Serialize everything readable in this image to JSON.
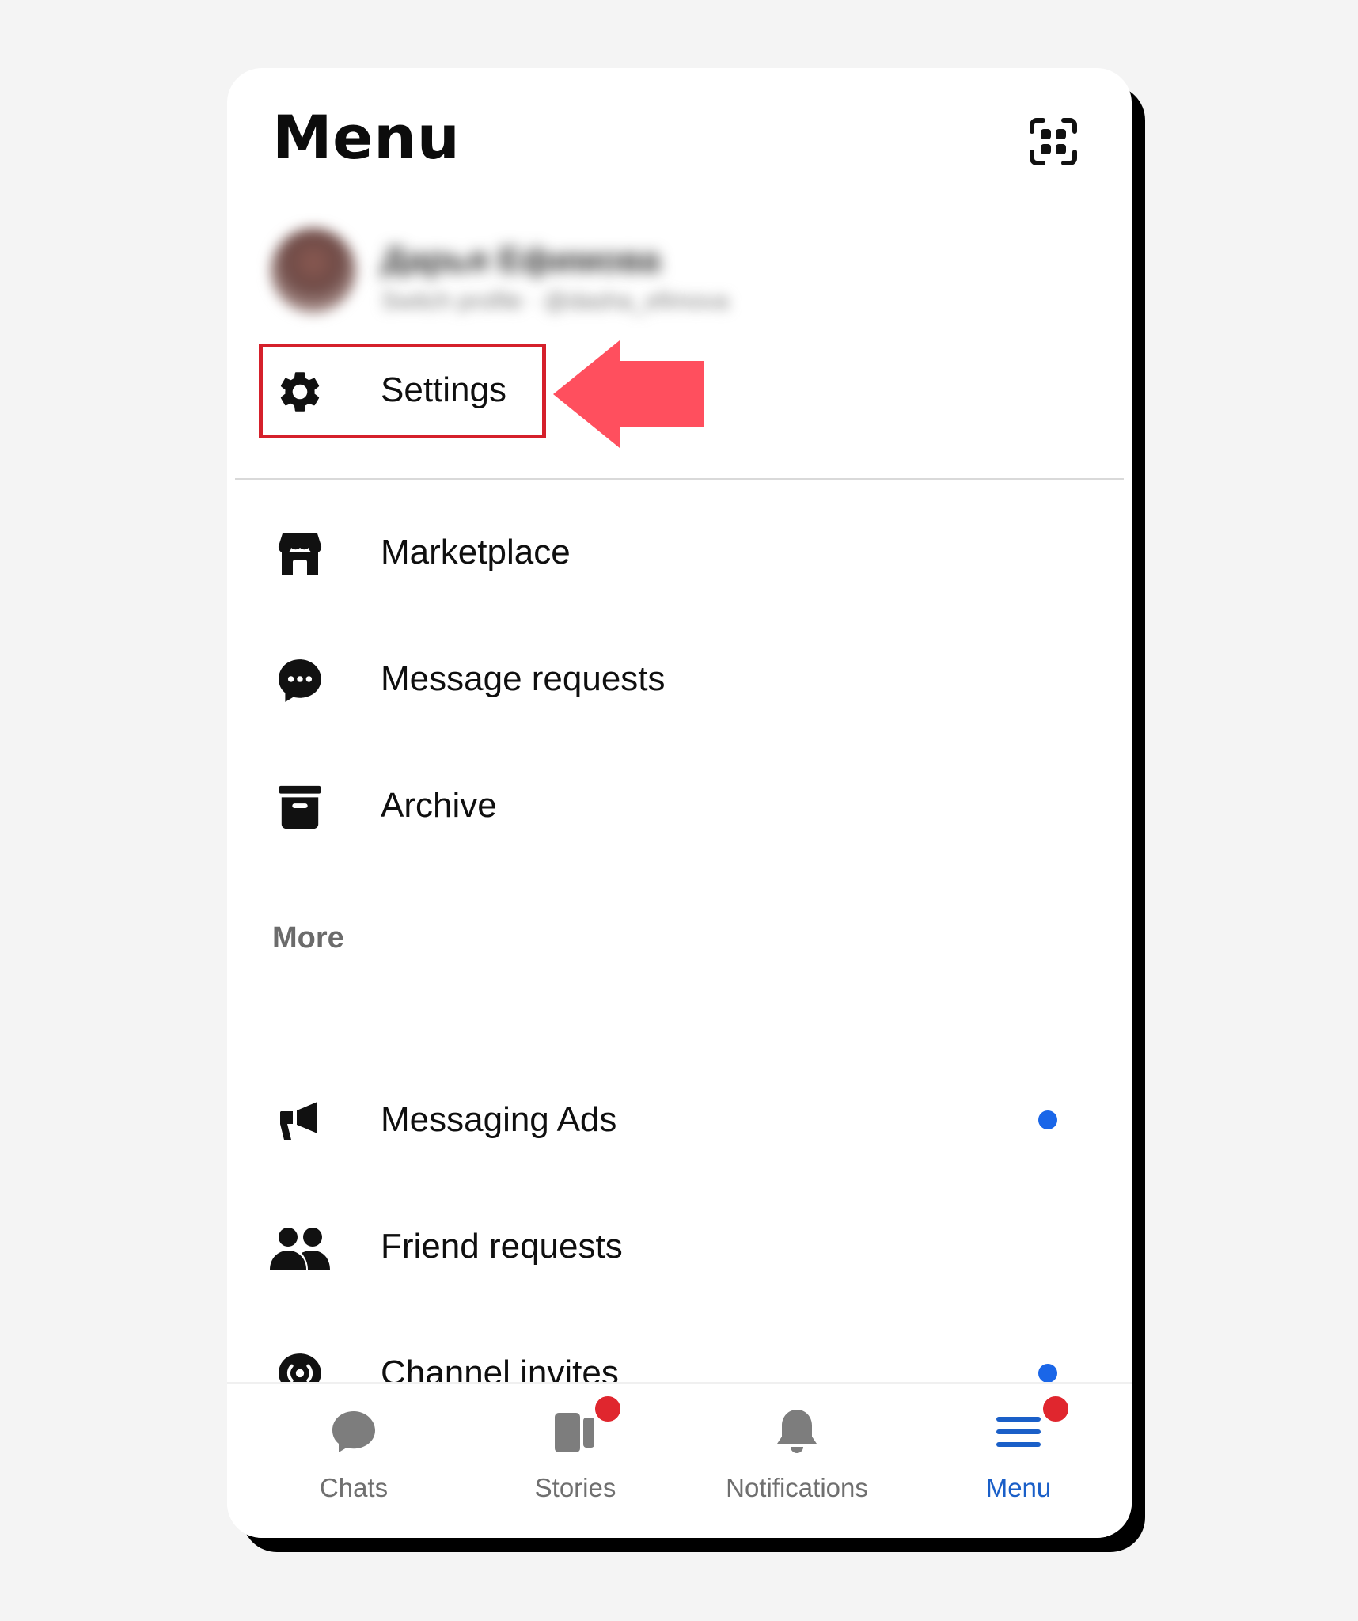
{
  "header": {
    "title": "Menu",
    "qr_icon": "qr-code-icon"
  },
  "profile": {
    "name": "Дарья Ефимова",
    "subtitle": "Switch profile · @dasha_efimova"
  },
  "settings": {
    "label": "Settings",
    "icon": "gear-icon",
    "highlight_color": "#d5202b",
    "arrow_color": "#ff4f5e"
  },
  "menu_items": [
    {
      "label": "Marketplace",
      "icon": "storefront-icon",
      "unread": false
    },
    {
      "label": "Message requests",
      "icon": "chat-bubble-dots-icon",
      "unread": false
    },
    {
      "label": "Archive",
      "icon": "archive-box-icon",
      "unread": false
    }
  ],
  "more_section": {
    "header": "More",
    "items": [
      {
        "label": "Messaging Ads",
        "icon": "megaphone-icon",
        "unread": true
      },
      {
        "label": "Friend requests",
        "icon": "people-icon",
        "unread": false
      },
      {
        "label": "Channel invites",
        "icon": "broadcast-channel-icon",
        "unread": true
      }
    ]
  },
  "tabbar": {
    "tabs": [
      {
        "label": "Chats",
        "icon": "chat-bubble-icon",
        "active": false,
        "badge": false
      },
      {
        "label": "Stories",
        "icon": "stories-icon",
        "active": false,
        "badge": true
      },
      {
        "label": "Notifications",
        "icon": "bell-icon",
        "active": false,
        "badge": false
      },
      {
        "label": "Menu",
        "icon": "hamburger-menu-icon",
        "active": true,
        "badge": true
      }
    ]
  },
  "colors": {
    "accent_blue": "#1a5fc8",
    "unread_dot": "#1a66e8",
    "badge_red": "#e0262e",
    "inactive_tab": "#6f6f6f"
  }
}
